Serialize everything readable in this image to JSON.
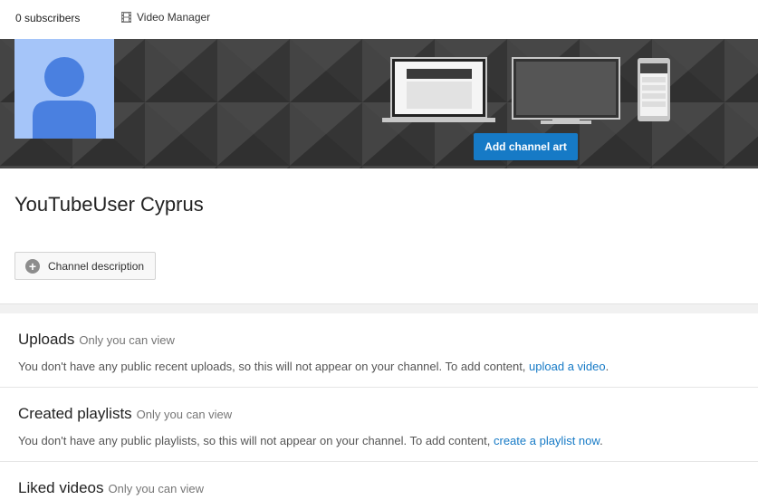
{
  "header": {
    "subscribers": "0 subscribers",
    "video_manager": "Video Manager"
  },
  "banner": {
    "add_art_label": "Add channel art"
  },
  "channel": {
    "name": "YouTubeUser Cyprus",
    "description_button": "Channel description"
  },
  "sections": [
    {
      "title": "Uploads",
      "note": "Only you can view",
      "text": "You don't have any public recent uploads, so this will not appear on your channel. To add content, ",
      "link": "upload a video",
      "suffix": "."
    },
    {
      "title": "Created playlists",
      "note": "Only you can view",
      "text": "You don't have any public playlists, so this will not appear on your channel. To add content, ",
      "link": "create a playlist now",
      "suffix": "."
    },
    {
      "title": "Liked videos",
      "note": "Only you can view"
    }
  ],
  "colors": {
    "accent": "#167ac6",
    "banner_bg": "#3a3a3a",
    "avatar_bg": "#a5c5f9",
    "avatar_figure": "#4a80e0"
  },
  "icons": {
    "video_manager": "film-strip-icon",
    "description": "plus-circle-icon"
  }
}
